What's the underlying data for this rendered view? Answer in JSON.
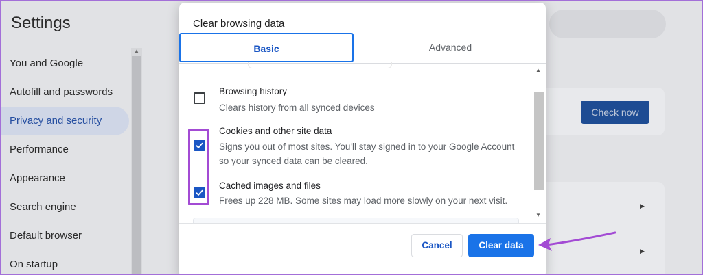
{
  "settings": {
    "title": "Settings",
    "sidebar": [
      {
        "label": "You and Google"
      },
      {
        "label": "Autofill and passwords"
      },
      {
        "label": "Privacy and security"
      },
      {
        "label": "Performance"
      },
      {
        "label": "Appearance"
      },
      {
        "label": "Search engine"
      },
      {
        "label": "Default browser"
      },
      {
        "label": "On startup"
      }
    ],
    "active_item": "Privacy and security",
    "check_now_label": "Check now"
  },
  "dialog": {
    "title": "Clear browsing data",
    "tabs": [
      {
        "label": "Basic",
        "selected": true
      },
      {
        "label": "Advanced",
        "selected": false
      }
    ],
    "options": [
      {
        "title": "Browsing history",
        "desc": "Clears history from all synced devices",
        "checked": false
      },
      {
        "title": "Cookies and other site data",
        "desc": "Signs you out of most sites. You'll stay signed in to your Google Account so your synced data can be cleared.",
        "checked": true
      },
      {
        "title": "Cached images and files",
        "desc": "Frees up 228 MB. Some sites may load more slowly on your next visit.",
        "checked": true
      }
    ],
    "cancel_label": "Cancel",
    "clear_label": "Clear data"
  },
  "colors": {
    "accent": "#1a73e8",
    "annotation": "#a34bd4",
    "overlay_bg": "#e1e2e5"
  },
  "icons": {
    "checkbox_checked": "check-icon",
    "annotation_arrow": "arrow-left-icon"
  }
}
